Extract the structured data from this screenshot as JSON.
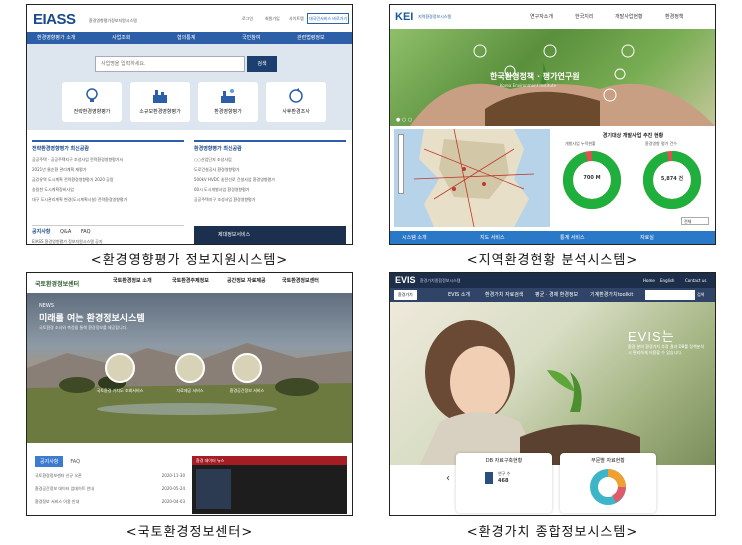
{
  "eiass": {
    "logo": "EIASS",
    "logo_sub": "환경영향평가정보지원시스템",
    "top_links": [
      "로그인",
      "회원가입",
      "사이트맵"
    ],
    "top_button": "대국민서비스 바로가기",
    "nav": [
      "환경영향평가 소개",
      "사업조회",
      "협의통계",
      "국민참여",
      "관련법령정보"
    ],
    "search_placeholder": "사업명을 입력하세요.",
    "search_button": "검색",
    "cards": [
      "전략환경영향평가",
      "소규모환경영향평가",
      "환경영향평가",
      "사후환경조사"
    ],
    "panel_left_title": "전략환경영향평가 최신공람",
    "panel_left_items": [
      "공공주택 - 공공주택지구 조성사업 전략환경영향평가서",
      "2021년 물순환 관리계획 재평가",
      "금강유역 도시계획 전략환경영향평가 2020 공람",
      "송림천 도시계획정비사업",
      "대구 도시관리계획 변경(도시계획시설) 전략환경영향평가"
    ],
    "panel_right_title": "환경영향평가 최신공람",
    "panel_right_items": [
      "○○산업단지 조성사업",
      "도로건설공사 환경영향평가",
      "500kV HVDC 송전선로 건설사업 환경영향평가",
      "00시 도시개발사업 환경영향평가",
      "공공주택지구 조성사업 환경영향평가"
    ],
    "bottom_tabs": [
      "공지사항",
      "Q&A",
      "FAQ"
    ],
    "bottom_item": "EIASS 환경영향평가 정보지원시스템 공지",
    "bottom_banner": "제대정보서비스"
  },
  "kei": {
    "logo": "KEI",
    "logo_sub": "지역환경정보시스템",
    "nav": [
      "연구자소개",
      "한국지리",
      "개발사업현황",
      "환경정책"
    ],
    "hero_title": "한국환경정책 · 평가연구원",
    "hero_sub": "Korea Environment Institute",
    "chart_title": "경기대상 개발사업 추진 현황",
    "chart_labels": [
      "개발사업 누적현황",
      "환경영향 평가 건수"
    ],
    "donut1_value": "700 M",
    "donut2_value": "5,874 건",
    "donut1_fraction": 0.96,
    "donut2_fraction": 0.97,
    "select_label": "전체",
    "bottom_tabs": [
      "시스템 소개",
      "지도 서비스",
      "통계 서비스",
      "자료실"
    ]
  },
  "nier": {
    "logo": "국토환경정보센터",
    "nav": [
      "국토환경정보 소개",
      "국토환경주제정보",
      "공간정보 자료제공",
      "국토환경정보센터"
    ],
    "hero_eyebrow": "NEWS",
    "hero_title": "미래를 여는 환경정보시스템",
    "hero_sub": "국토환경 조사와 측정을 통해 환경정보를 제공합니다.",
    "circles": [
      "국토환경 가치도 조회서비스",
      "자료제공 서비스",
      "환경공간정보 서비스"
    ],
    "tabs": [
      "공지사항",
      "FAQ"
    ],
    "notices": [
      {
        "title": "국토환경정보센터 신규 오픈",
        "date": "2020-11-30"
      },
      {
        "title": "환경공간정보 데이터 업데이트 안내",
        "date": "2020-05-24"
      },
      {
        "title": "환경정보 서비스 이용 안내",
        "date": "2020-04-03"
      }
    ],
    "dark_title": "환경 데이터 뉴스"
  },
  "evis": {
    "logo": "EVIS",
    "logo_sub": "환경가치종합정보시스템",
    "top_links": [
      "Home",
      "English",
      "Contact us"
    ],
    "nav": [
      "EVIS 소개",
      "환경가치 자료검색",
      "평균 · 경제 환경정보",
      "기계환경가치toolkit"
    ],
    "select_label": "환경가치",
    "search_button": "검색",
    "hero_title": "EVIS는",
    "hero_desc": "환경 분야 환경가치 추정 결과 DB를 정책분석 시 편리하게 이용할 수 있습니다.",
    "card1_title": "DB 자료구축현황",
    "card1_label": "연구 수",
    "card1_value": "468",
    "card2_title": "부문별 자료현황"
  },
  "captions": [
    "<환경영향평가 정보지원시스템>",
    "<지역환경현황 분석시스템>",
    "<국토환경정보센터>",
    "<환경가치 종합정보시스템>"
  ]
}
